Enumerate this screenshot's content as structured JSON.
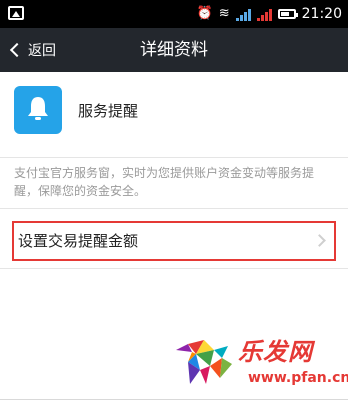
{
  "status_bar": {
    "time": "21:20"
  },
  "nav": {
    "back_label": "返回",
    "title": "详细资料"
  },
  "service": {
    "name": "服务提醒",
    "icon": "bell-icon",
    "icon_color": "#25a3e8"
  },
  "description": "支付宝官方服务窗，实时为您提供账户资金变动等服务提醒，保障您的资金安全。",
  "settings_row": {
    "label": "设置交易提醒金额",
    "highlight_color": "#e53935"
  },
  "watermark": {
    "brand": "乐发网",
    "url": "www.pfan.cn"
  }
}
